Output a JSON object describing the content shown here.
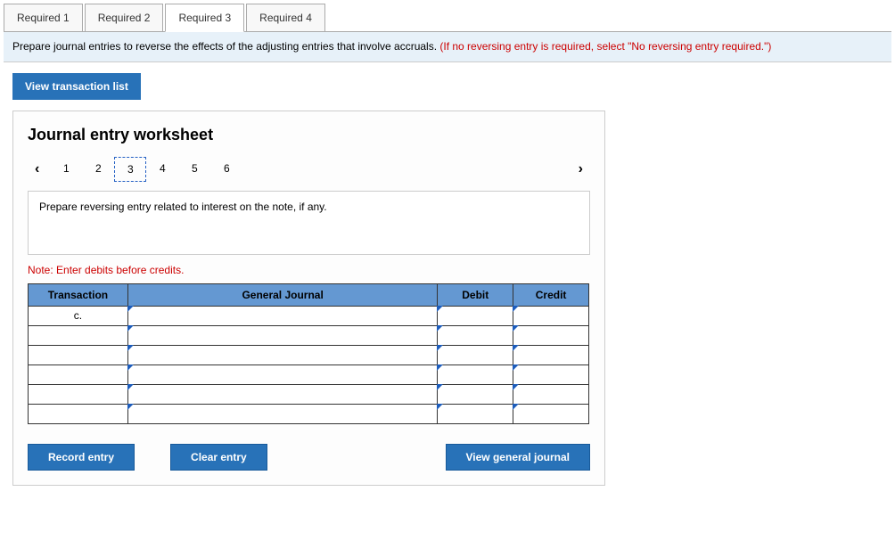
{
  "tabs": {
    "t1": "Required 1",
    "t2": "Required 2",
    "t3": "Required 3",
    "t4": "Required 4"
  },
  "instruction": {
    "black": "Prepare journal entries to reverse the effects of the adjusting entries that involve accruals. ",
    "red": "(If no reversing entry is required, select \"No reversing entry required.\")"
  },
  "view_txn_btn": "View transaction list",
  "worksheet": {
    "title": "Journal entry worksheet",
    "pager": {
      "n1": "1",
      "n2": "2",
      "n3": "3",
      "n4": "4",
      "n5": "5",
      "n6": "6"
    },
    "prompt": "Prepare reversing entry related to interest on the note, if any.",
    "note": "Note: Enter debits before credits.",
    "headers": {
      "trans": "Transaction",
      "gj": "General Journal",
      "debit": "Debit",
      "credit": "Credit"
    },
    "first_trans": "c.",
    "buttons": {
      "record": "Record entry",
      "clear": "Clear entry",
      "view_gj": "View general journal"
    }
  }
}
